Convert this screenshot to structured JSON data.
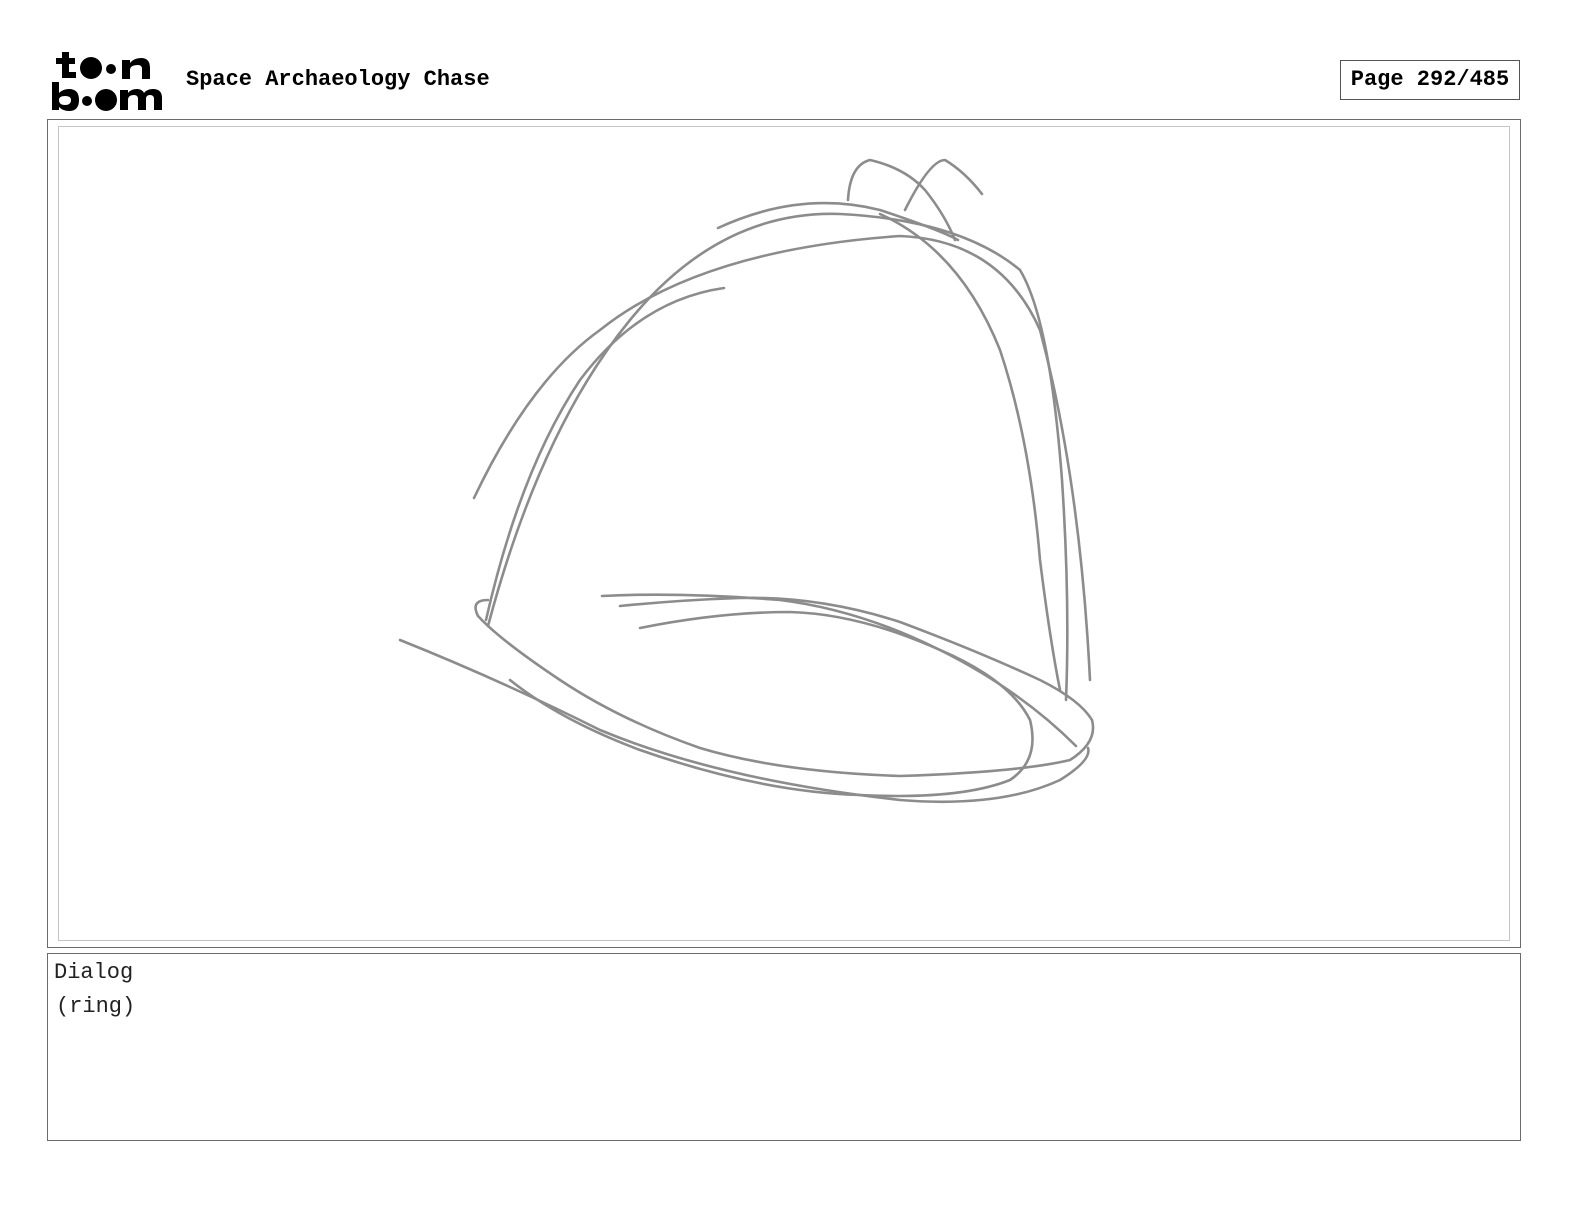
{
  "header": {
    "logo_text": "toon boom",
    "project_title": "Space Archaeology Chase",
    "page_label": "Page 292/485"
  },
  "panel": {
    "sketch_subject": "hard-hat-sketch"
  },
  "dialog": {
    "label": "Dialog",
    "text": "(ring)"
  }
}
